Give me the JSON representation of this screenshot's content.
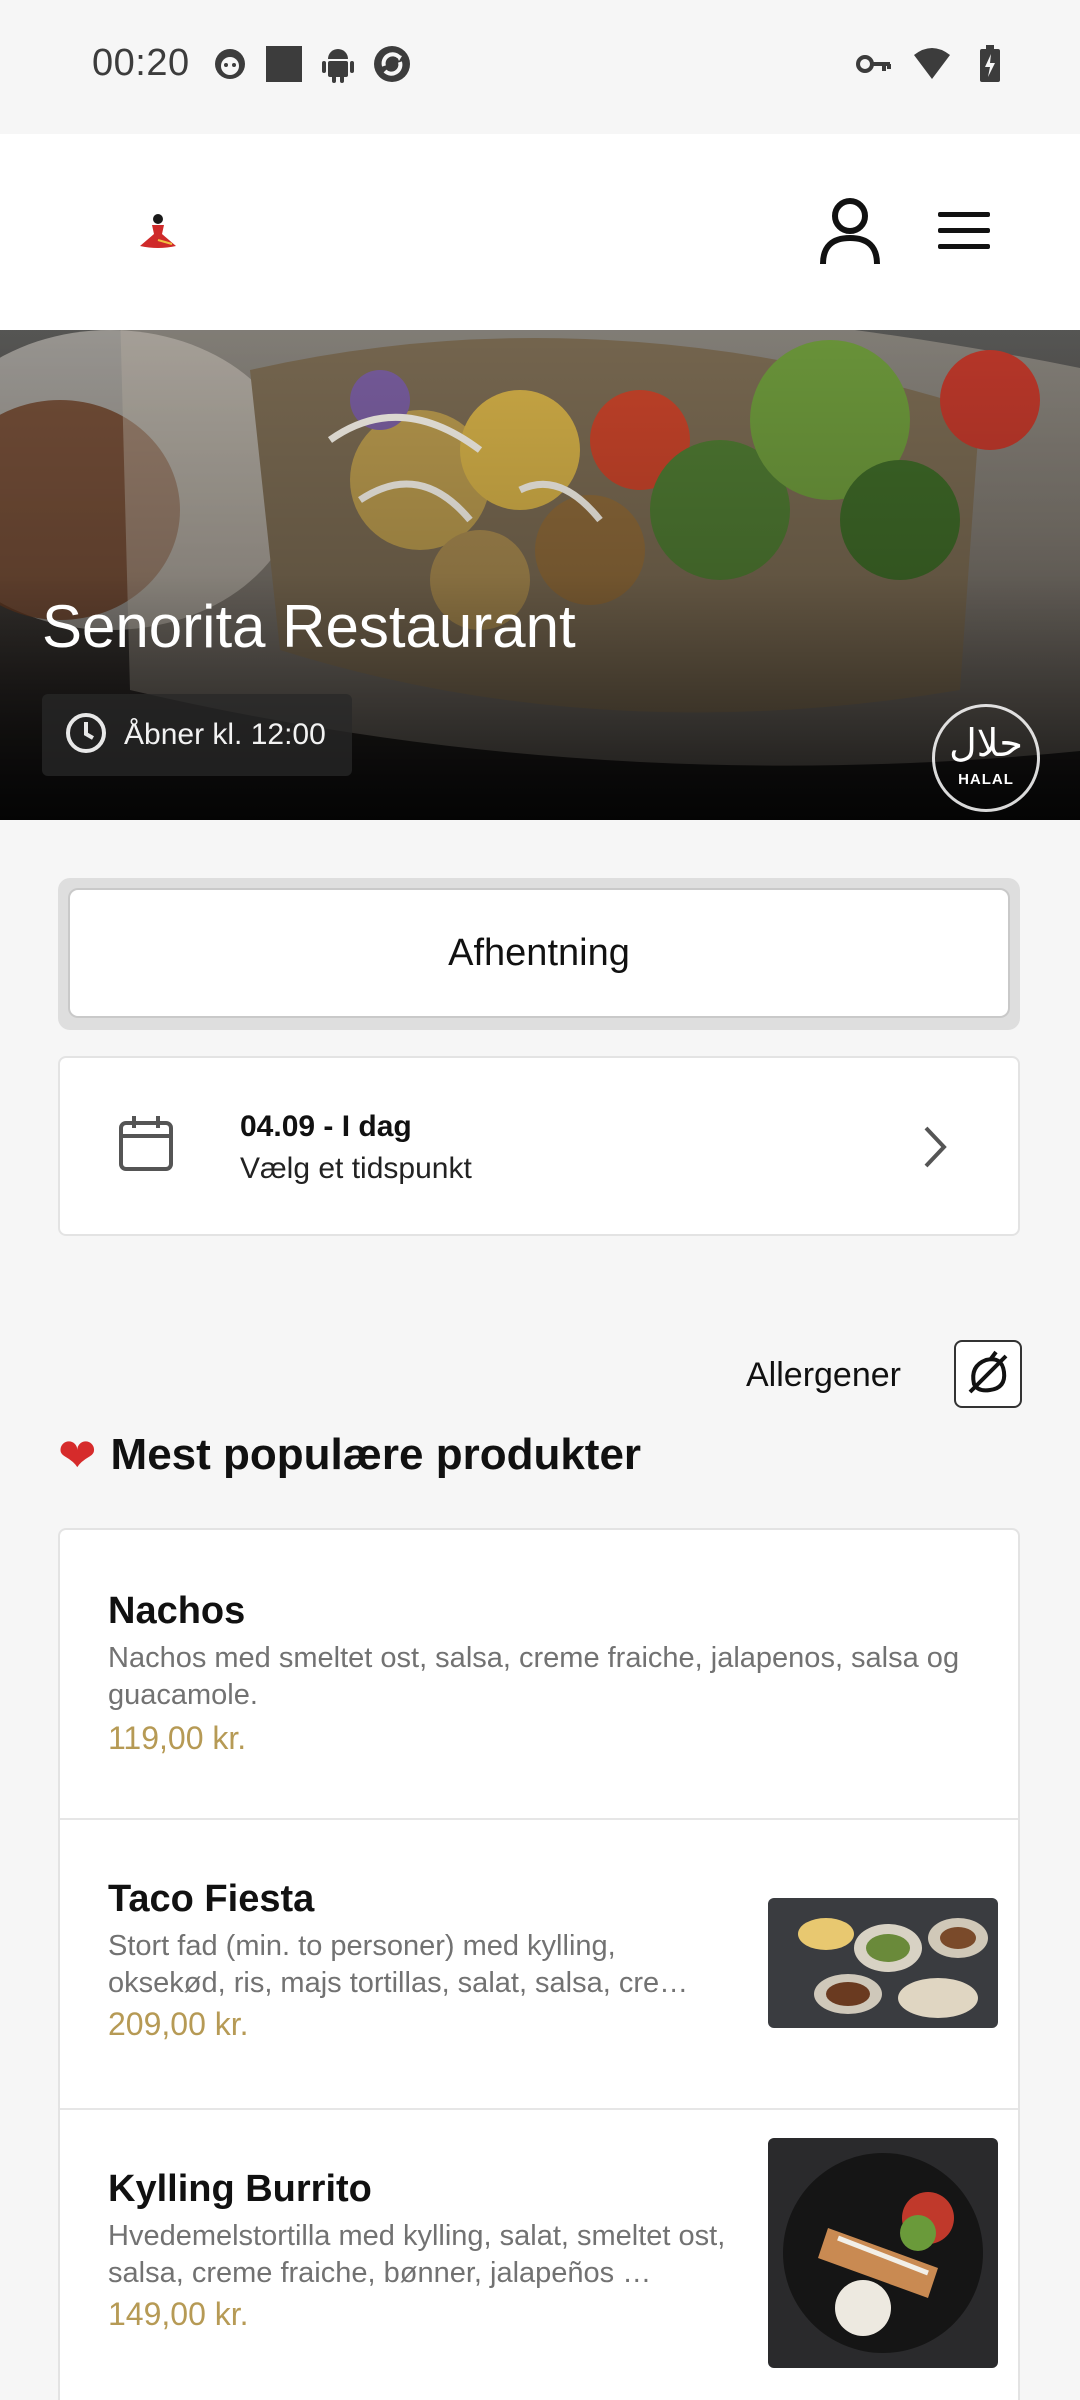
{
  "status_bar": {
    "time": "00:20",
    "left_icons": [
      "cat-face-icon",
      "square-icon",
      "android-icon",
      "sync-icon"
    ],
    "right_icons": [
      "key-icon",
      "wifi-icon",
      "battery-charging-icon"
    ]
  },
  "header": {
    "logo": "senorita-logo",
    "account_icon": "user-icon",
    "menu_icon": "hamburger-menu-icon"
  },
  "hero": {
    "title": "Senorita Restaurant",
    "hours": "Åbner kl. 12:00",
    "badge_arabic": "حلال",
    "badge_latin": "HALAL"
  },
  "order_type": {
    "label": "Afhentning"
  },
  "date_picker": {
    "date": "04.09 - I dag",
    "prompt": "Vælg et tidspunkt"
  },
  "allergens": {
    "label": "Allergener"
  },
  "popular": {
    "heading": "Mest populære produkter",
    "products": [
      {
        "name": "Nachos",
        "description": "Nachos med smeltet ost, salsa, creme fraiche, jalapenos, salsa og guacamole.",
        "price": "119,00 kr."
      },
      {
        "name": "Taco Fiesta",
        "description": "Stort fad (min. to personer) med kylling, oksekød, ris, majs tortillas, salat, salsa, cre…",
        "price": "209,00 kr."
      },
      {
        "name": "Kylling Burrito",
        "description": "Hvedemelstortilla med kylling, salat, smeltet ost, salsa, creme fraiche, bønner, jalapeños …",
        "price": "149,00 kr."
      }
    ]
  },
  "colors": {
    "price": "#b69a55",
    "heart": "#d62b2b"
  }
}
